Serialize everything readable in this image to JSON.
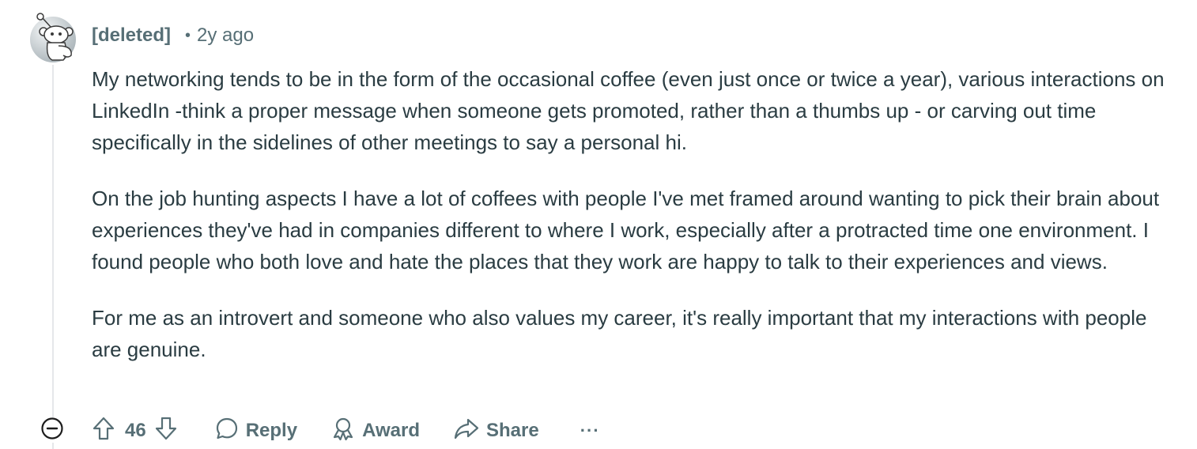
{
  "comment": {
    "author": "[deleted]",
    "separator": "•",
    "timestamp": "2y ago",
    "paragraphs": [
      "My networking tends to be in the form of the occasional coffee (even just once or twice a year), various interactions on LinkedIn -think a proper message when someone gets promoted, rather than a thumbs up - or carving out time specifically in the sidelines of other meetings to say a personal hi.",
      "On the job hunting aspects I have a lot of coffees with people I've met framed around wanting to pick their brain about experiences they've had in companies different to where I work, especially after a protracted time one environment. I found people who both love and hate the places that they work are happy to talk to their experiences and views.",
      "For me as an introvert and someone who also values my career, it's really important that my interactions with people are genuine."
    ]
  },
  "actions": {
    "score": "46",
    "reply_label": "Reply",
    "award_label": "Award",
    "share_label": "Share",
    "more_label": "···"
  },
  "icons": {
    "avatar": "snoo-avatar-icon",
    "collapse": "collapse-minus-icon",
    "upvote": "upvote-arrow-icon",
    "downvote": "downvote-arrow-icon",
    "reply": "speech-bubble-icon",
    "award": "award-ribbon-icon",
    "share": "share-arrow-icon"
  },
  "colors": {
    "meta_text": "#576f76",
    "body_text": "#2a3c42",
    "thread_line": "#e5e7ea"
  }
}
